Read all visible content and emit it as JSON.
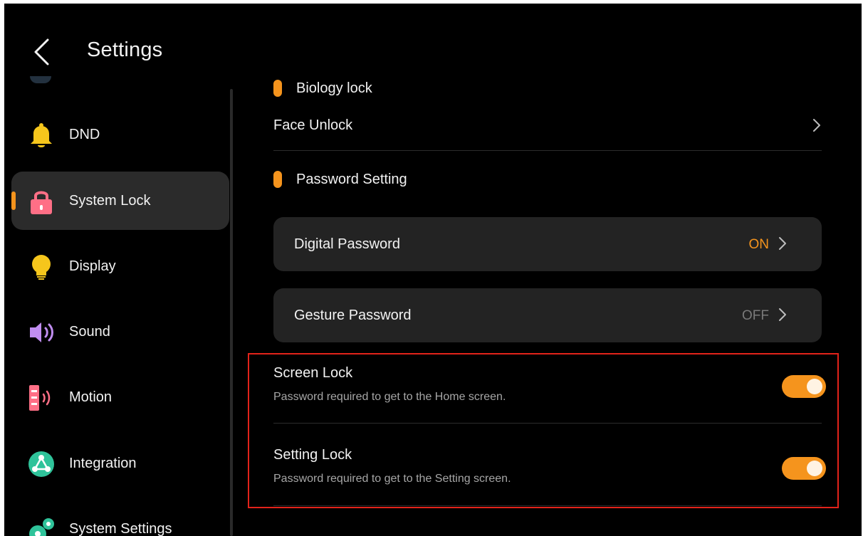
{
  "header": {
    "title": "Settings"
  },
  "sidebar": {
    "items": [
      {
        "label": "DND",
        "icon": "bell-icon"
      },
      {
        "label": "System Lock",
        "icon": "lock-icon",
        "active": true
      },
      {
        "label": "Display",
        "icon": "lightbulb-icon"
      },
      {
        "label": "Sound",
        "icon": "speaker-icon"
      },
      {
        "label": "Motion",
        "icon": "motion-sensor-icon"
      },
      {
        "label": "Integration",
        "icon": "integration-icon"
      },
      {
        "label": "System Settings",
        "icon": "system-settings-icon"
      }
    ]
  },
  "main": {
    "biology_section": {
      "title": "Biology lock"
    },
    "face_unlock": {
      "label": "Face Unlock"
    },
    "password_section": {
      "title": "Password Setting"
    },
    "digital_password": {
      "label": "Digital Password",
      "status": "ON"
    },
    "gesture_password": {
      "label": "Gesture Password",
      "status": "OFF"
    },
    "screen_lock": {
      "title": "Screen Lock",
      "description": "Password required to get to the Home screen.",
      "enabled": true
    },
    "setting_lock": {
      "title": "Setting Lock",
      "description": "Password required to get to the Setting screen.",
      "enabled": true
    }
  },
  "colors": {
    "accent": "#f5941d",
    "background": "#000000",
    "card": "#232323",
    "highlight_border": "#e2231a"
  }
}
